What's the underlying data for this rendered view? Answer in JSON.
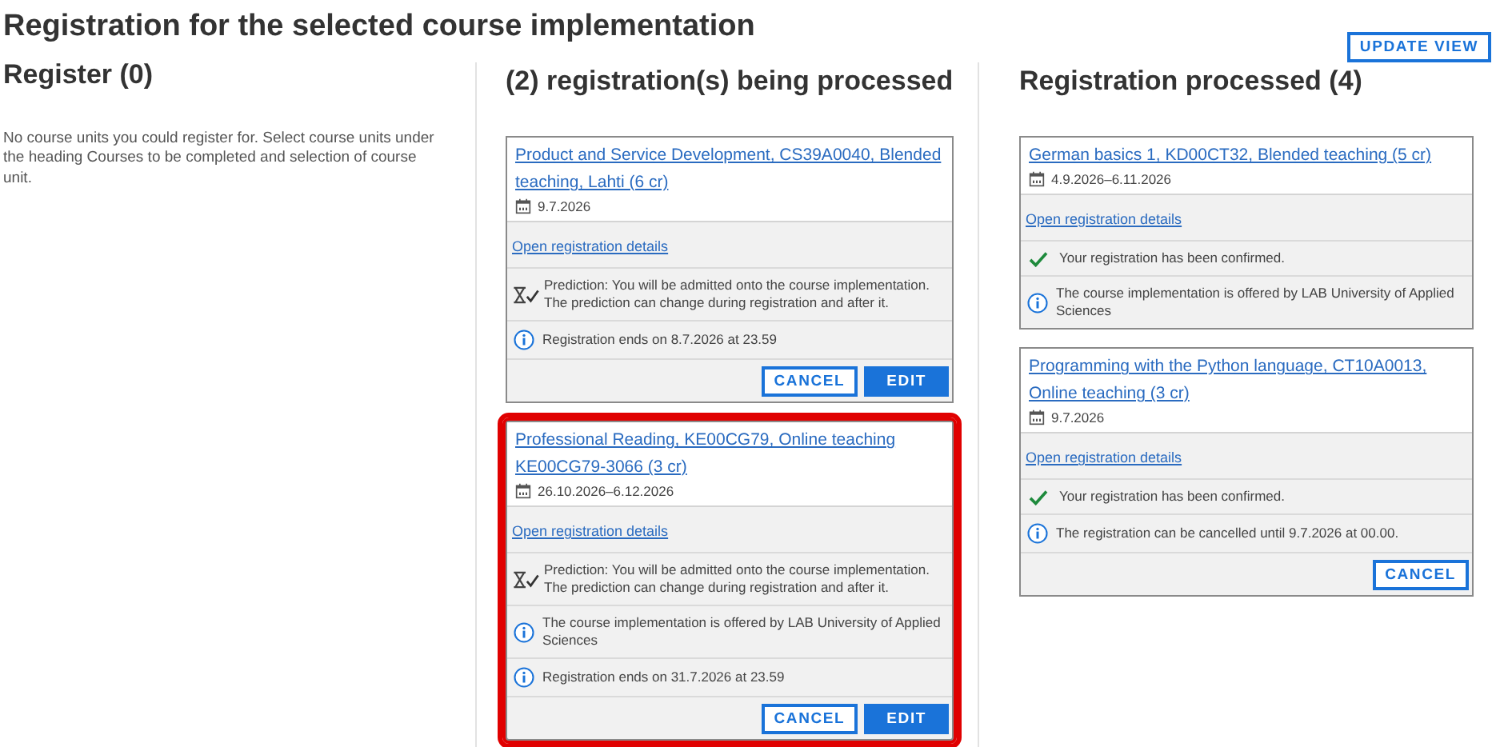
{
  "title": "Registration for the selected course implementation",
  "update_button": "UPDATE VIEW",
  "columns": [
    {
      "heading": "Register (0)",
      "text": "No course units you could register for. Select course units under the heading Courses to be completed and selection of course unit."
    },
    {
      "heading": "(2) registration(s) being processed",
      "cards": [
        {
          "title": "Product and Service Development, CS39A0040, Blended teaching, Lahti (6 cr)",
          "date": "9.7.2026",
          "details_link": "Open registration details",
          "highlighted": false,
          "notes": [
            {
              "kind": "prediction",
              "text": "Prediction: You will be admitted onto the course implementation. The prediction can change during registration and after it."
            },
            {
              "kind": "info",
              "text": "Registration ends on 8.7.2026 at 23.59"
            }
          ],
          "buttons": [
            {
              "kind": "secondary",
              "label": "CANCEL"
            },
            {
              "kind": "primary",
              "label": "EDIT"
            }
          ]
        },
        {
          "title": "Professional Reading, KE00CG79, Online teaching KE00CG79-3066 (3 cr)",
          "date": "26.10.2026–6.12.2026",
          "details_link": "Open registration details",
          "highlighted": true,
          "notes": [
            {
              "kind": "prediction",
              "text": "Prediction: You will be admitted onto the course implementation. The prediction can change during registration and after it."
            },
            {
              "kind": "info",
              "text": "The course implementation is offered by LAB University of Applied Sciences"
            },
            {
              "kind": "info",
              "text": "Registration ends on 31.7.2026 at 23.59"
            }
          ],
          "buttons": [
            {
              "kind": "secondary",
              "label": "CANCEL"
            },
            {
              "kind": "primary",
              "label": "EDIT"
            }
          ]
        }
      ]
    },
    {
      "heading": "Registration processed (4)",
      "cards": [
        {
          "title": "German basics 1, KD00CT32, Blended teaching (5 cr)",
          "date": "4.9.2026–6.11.2026",
          "details_link": "Open registration details",
          "highlighted": false,
          "notes": [
            {
              "kind": "confirmed",
              "text": "Your registration has been confirmed."
            },
            {
              "kind": "info",
              "text": "The course implementation is offered by LAB University of Applied Sciences"
            }
          ]
        },
        {
          "title": "Programming with the Python language, CT10A0013, Online teaching (3 cr)",
          "date": "9.7.2026",
          "details_link": "Open registration details",
          "highlighted": false,
          "notes": [
            {
              "kind": "confirmed",
              "text": "Your registration has been confirmed."
            },
            {
              "kind": "info",
              "text": "The registration can be cancelled until 9.7.2026 at 00.00."
            }
          ],
          "buttons": [
            {
              "kind": "secondary",
              "label": "CANCEL"
            }
          ]
        }
      ]
    }
  ]
}
